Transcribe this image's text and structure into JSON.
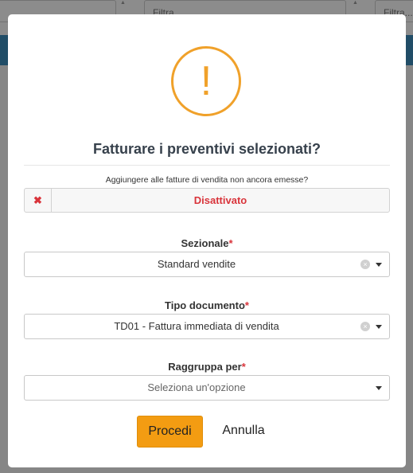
{
  "background": {
    "filters": [
      {
        "placeholder": ""
      },
      {
        "placeholder": "Filtra..."
      },
      {
        "placeholder": "Filtra..."
      }
    ]
  },
  "modal": {
    "icon": "exclamation-icon",
    "title": "Fatturare i preventivi selezionati?",
    "question": "Aggiungere alle fatture di vendita non ancora emesse?",
    "toggle": {
      "label": "Disattivato",
      "icon": "close-x-icon",
      "state": "off"
    },
    "fields": {
      "sezionale": {
        "label": "Sezionale",
        "required": "*",
        "value": "Standard vendite"
      },
      "tipo_documento": {
        "label": "Tipo documento",
        "required": "*",
        "value": "TD01 - Fattura immediata di vendita"
      },
      "raggruppa_per": {
        "label": "Raggruppa per",
        "required": "*",
        "placeholder": "Seleziona un'opzione"
      }
    },
    "buttons": {
      "confirm": "Procedi",
      "cancel": "Annulla"
    }
  },
  "colors": {
    "warning": "#f0a12a",
    "primary_button": "#f39c12",
    "danger": "#d9343b",
    "header_bar": "#3c8dbc"
  }
}
